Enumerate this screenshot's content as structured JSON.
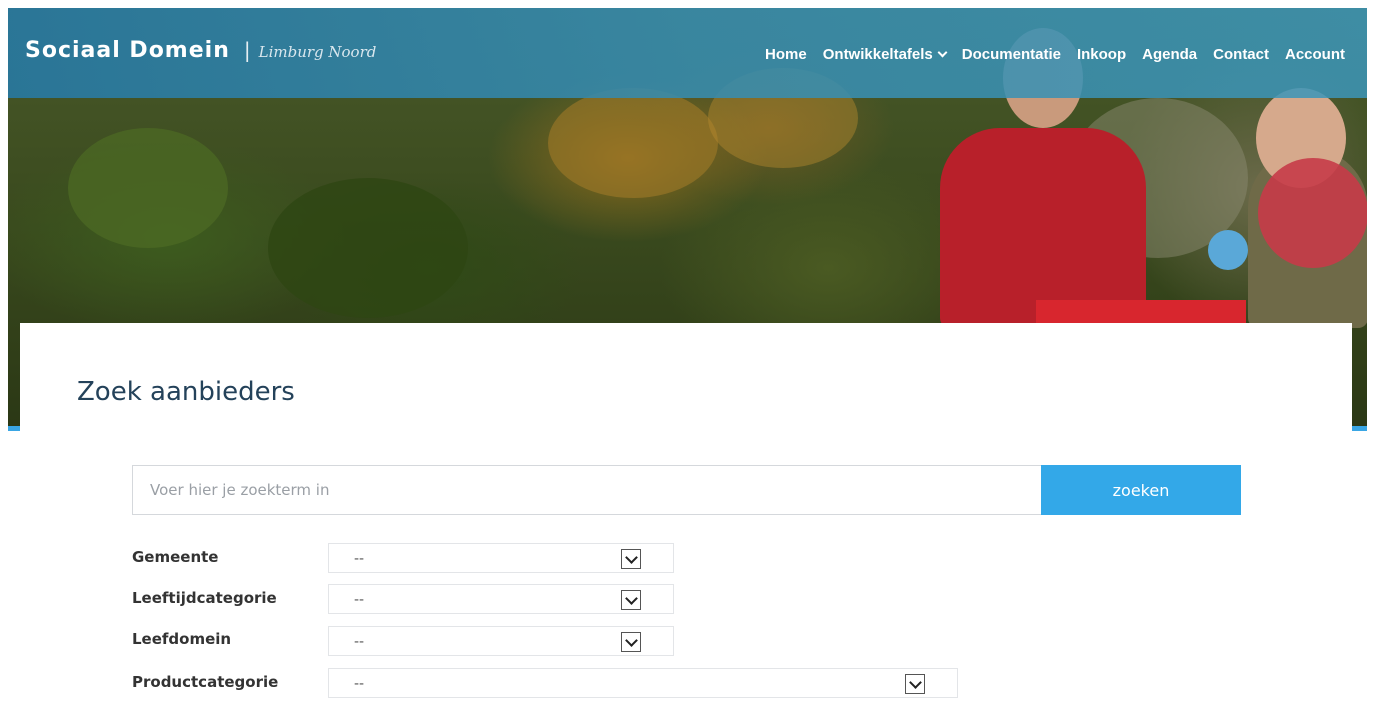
{
  "header": {
    "brand_name": "Sociaal Domein",
    "brand_separator": "|",
    "brand_region": "Limburg Noord",
    "nav": [
      {
        "label": "Home"
      },
      {
        "label": "Ontwikkeltafels",
        "has_dropdown": true
      },
      {
        "label": "Documentatie"
      },
      {
        "label": "Inkoop"
      },
      {
        "label": "Agenda"
      },
      {
        "label": "Contact"
      },
      {
        "label": "Account"
      }
    ]
  },
  "main": {
    "title": "Zoek aanbieders",
    "search": {
      "placeholder": "Voer hier je zoekterm in",
      "value": "",
      "button_label": "zoeken"
    },
    "filters": [
      {
        "label": "Gemeente",
        "selected": "--"
      },
      {
        "label": "Leeftijdcategorie",
        "selected": "--"
      },
      {
        "label": "Leefdomein",
        "selected": "--"
      },
      {
        "label": "Productcategorie",
        "selected": "--"
      }
    ]
  },
  "colors": {
    "nav_bar": "#2f87b0",
    "accent": "#33a8e8",
    "title": "#24425a"
  }
}
